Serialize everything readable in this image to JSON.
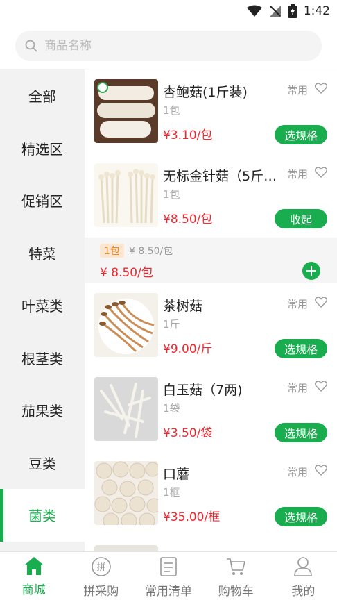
{
  "status_bar": {
    "time": "1:42"
  },
  "search": {
    "placeholder": "商品名称"
  },
  "sidebar": {
    "items": [
      {
        "label": "全部"
      },
      {
        "label": "精选区"
      },
      {
        "label": "促销区"
      },
      {
        "label": "特菜"
      },
      {
        "label": "叶菜类"
      },
      {
        "label": "根茎类"
      },
      {
        "label": "茄果类"
      },
      {
        "label": "豆类"
      },
      {
        "label": "菌类"
      }
    ],
    "active_index": 8
  },
  "products": [
    {
      "name": "杏鲍菇(1斤装)",
      "unit": "1包",
      "price": "¥3.10/包",
      "tag": "常用",
      "button": "选规格"
    },
    {
      "name": "无标金针菇（5斤…",
      "unit": "1包",
      "price": "¥8.50/包",
      "tag": "常用",
      "button": "收起"
    },
    {
      "name": "茶树菇",
      "unit": "1斤",
      "price": "¥9.00/斤",
      "tag": "常用",
      "button": "选规格"
    },
    {
      "name": "白玉菇（7两)",
      "unit": "1袋",
      "price": "¥3.50/袋",
      "tag": "常用",
      "button": "选规格"
    },
    {
      "name": "口蘑",
      "unit": "1框",
      "price": "¥35.00/框",
      "tag": "常用",
      "button": "选规格"
    }
  ],
  "spec_panel": {
    "chip": "1包",
    "sub_price": "¥ 8.50/包",
    "price": "¥ 8.50/包"
  },
  "tabbar": {
    "items": [
      {
        "label": "商城",
        "icon": "home-icon"
      },
      {
        "label": "拼采购",
        "icon": "group-buy-icon"
      },
      {
        "label": "常用清单",
        "icon": "list-icon"
      },
      {
        "label": "购物车",
        "icon": "cart-icon"
      },
      {
        "label": "我的",
        "icon": "user-icon"
      }
    ],
    "active_index": 0
  },
  "colors": {
    "accent": "#1aad4f",
    "price": "#f0272f",
    "sidebar_bg": "#f2f2f2"
  }
}
